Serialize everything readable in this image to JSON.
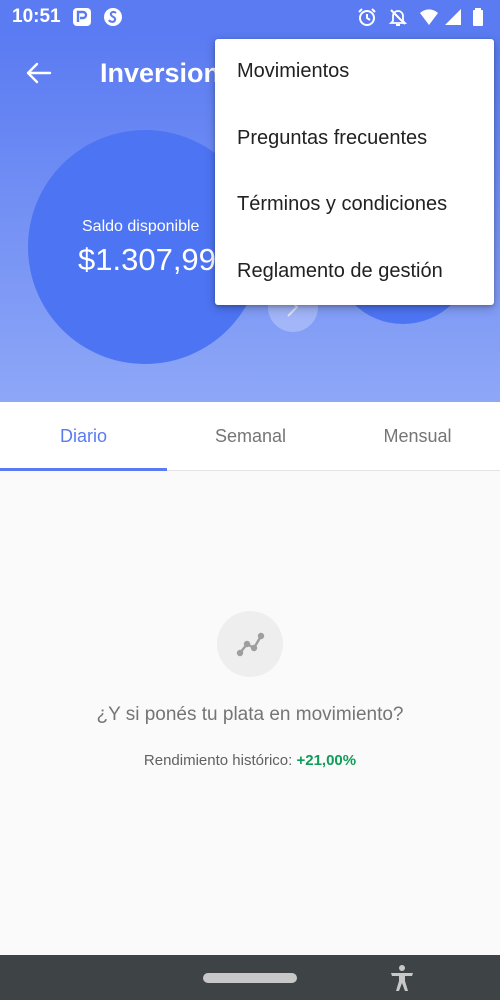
{
  "status_bar": {
    "time": "10:51",
    "app_icons": [
      "p-app-icon",
      "s-app-icon"
    ],
    "right_icons": [
      "alarm-icon",
      "notifications-off-icon",
      "wifi-icon",
      "signal-icon",
      "battery-icon"
    ]
  },
  "header": {
    "title": "Inversion",
    "back_icon": "arrow-left-icon"
  },
  "balance": {
    "label": "Saldo disponible",
    "value": "$1.307,99"
  },
  "menu": {
    "items": [
      {
        "label": "Movimientos"
      },
      {
        "label": "Preguntas frecuentes"
      },
      {
        "label": "Términos y condiciones"
      },
      {
        "label": "Reglamento de gestión"
      }
    ]
  },
  "tabs": [
    {
      "label": "Diario",
      "selected": true
    },
    {
      "label": "Semanal",
      "selected": false
    },
    {
      "label": "Mensual",
      "selected": false
    }
  ],
  "empty_state": {
    "icon": "trend-line-icon",
    "title": "¿Y si ponés tu plata en movimiento?",
    "subtitle_prefix": "Rendimiento histórico:",
    "subtitle_value": "+21,00%"
  },
  "colors": {
    "primary": "#5a7bf2",
    "circle": "#4d74f3",
    "positive": "#0f9d58"
  },
  "nav_bar": {
    "accessibility_icon": "accessibility-icon"
  }
}
